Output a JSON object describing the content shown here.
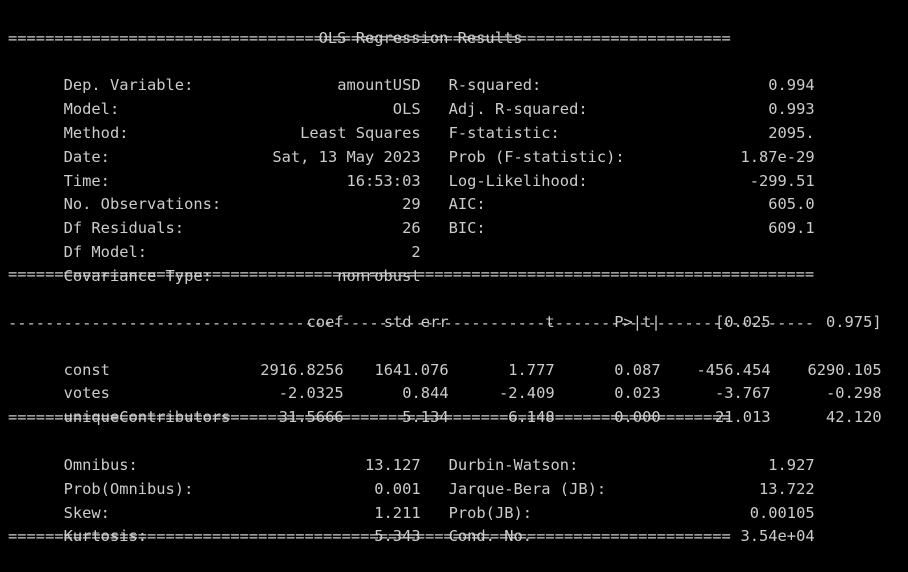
{
  "title": "OLS Regression Results",
  "rules": {
    "double_short": "==============================================================================",
    "double_long": "=======================================================================================",
    "dash_long": "---------------------------------------------------------------------------------------"
  },
  "summary": [
    {
      "left_label": "Dep. Variable:",
      "left_value": "amountUSD",
      "right_label": "R-squared:",
      "right_value": "0.994"
    },
    {
      "left_label": "Model:",
      "left_value": "OLS",
      "right_label": "Adj. R-squared:",
      "right_value": "0.993"
    },
    {
      "left_label": "Method:",
      "left_value": "Least Squares",
      "right_label": "F-statistic:",
      "right_value": "2095."
    },
    {
      "left_label": "Date:",
      "left_value": "Sat, 13 May 2023",
      "right_label": "Prob (F-statistic):",
      "right_value": "1.87e-29"
    },
    {
      "left_label": "Time:",
      "left_value": "16:53:03",
      "right_label": "Log-Likelihood:",
      "right_value": "-299.51"
    },
    {
      "left_label": "No. Observations:",
      "left_value": "29",
      "right_label": "AIC:",
      "right_value": "605.0"
    },
    {
      "left_label": "Df Residuals:",
      "left_value": "26",
      "right_label": "BIC:",
      "right_value": "609.1"
    },
    {
      "left_label": "Df Model:",
      "left_value": "2",
      "right_label": "",
      "right_value": ""
    },
    {
      "left_label": "Covariance Type:",
      "left_value": "nonrobust",
      "right_label": "",
      "right_value": ""
    }
  ],
  "coef_table": {
    "headers": [
      "coef",
      "std err",
      "t",
      "P>|t|",
      "[0.025",
      "0.975]"
    ],
    "rows": [
      {
        "name": "const",
        "values": [
          "2916.8256",
          "1641.076",
          "1.777",
          "0.087",
          "-456.454",
          "6290.105"
        ]
      },
      {
        "name": "votes",
        "values": [
          "-2.0325",
          "0.844",
          "-2.409",
          "0.023",
          "-3.767",
          "-0.298"
        ]
      },
      {
        "name": "uniqueContributors",
        "values": [
          "31.5666",
          "5.134",
          "6.148",
          "0.000",
          "21.013",
          "42.120"
        ]
      }
    ]
  },
  "diagnostics": [
    {
      "left_label": "Omnibus:",
      "left_value": "13.127",
      "right_label": "Durbin-Watson:",
      "right_value": "1.927"
    },
    {
      "left_label": "Prob(Omnibus):",
      "left_value": "0.001",
      "right_label": "Jarque-Bera (JB):",
      "right_value": "13.722"
    },
    {
      "left_label": "Skew:",
      "left_value": "1.211",
      "right_label": "Prob(JB):",
      "right_value": "0.00105"
    },
    {
      "left_label": "Kurtosis:",
      "left_value": "5.343",
      "right_label": "Cond. No.",
      "right_value": "3.54e+04"
    }
  ]
}
